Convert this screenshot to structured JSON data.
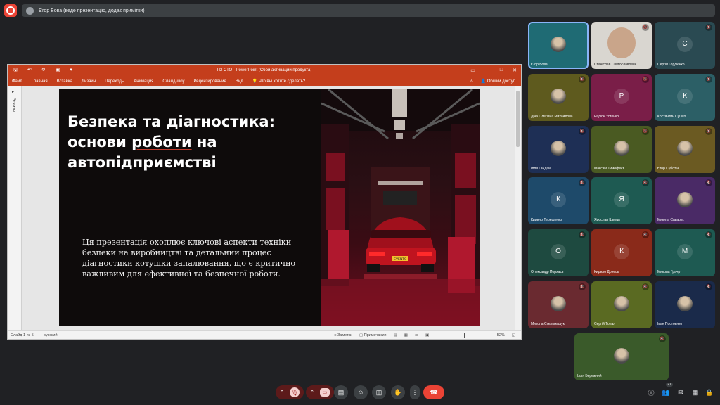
{
  "top_bar": {
    "presenter_text": "Єгор Бова (веде презентацію, додає примітки)"
  },
  "ppt": {
    "window_title": "П2 СТО - PowerPoint (Сбой активации продукта)",
    "menu": [
      "Файл",
      "Главная",
      "Вставка",
      "Дизайн",
      "Переходы",
      "Анимация",
      "Слайд-шоу",
      "Рецензирование",
      "Вид"
    ],
    "tell_me": "Что вы хотите сделать?",
    "share": "Общий доступ",
    "thumbs_label": "Эскизы",
    "status": {
      "slide": "Слайд 1 из 5",
      "lang": "русский",
      "notes": "Заметки",
      "comments": "Примечания",
      "zoom": "52%"
    },
    "slide": {
      "title_line1": "Безпека та діагностика:",
      "title_line2_a": "основи",
      "title_line2_b": "роботи",
      "title_line2_c": "на",
      "title_line3": "автопідприємстві",
      "body": "Ця презентація охоплює ключові аспекти техніки безпеки на виробництві та детальний процес діагностики котушки запалювання, що є критично важливим для ефективної та безпечної роботи.",
      "plate": "EVENTS"
    }
  },
  "participants": [
    {
      "name": "Єгор Бова",
      "initial": "",
      "bg": "#1f6b74",
      "active": true
    },
    {
      "name": "Станіслав Святославович",
      "initial": "",
      "bg": "#d9d6d0",
      "active": false
    },
    {
      "name": "Сергій Гордієнко",
      "initial": "С",
      "bg": "#2a4a52",
      "active": false
    },
    {
      "name": "Діна Олегівна Михайлова",
      "initial": "",
      "bg": "#5e5a1e",
      "active": false
    },
    {
      "name": "Радіон Устенко",
      "initial": "Р",
      "bg": "#7a1e48",
      "active": false
    },
    {
      "name": "Костянтин Сушко",
      "initial": "К",
      "bg": "#2c5f66",
      "active": false
    },
    {
      "name": "Ілля Гайдай",
      "initial": "",
      "bg": "#1e2f55",
      "active": false
    },
    {
      "name": "Максим Тимофеєв",
      "initial": "",
      "bg": "#4a5a22",
      "active": false
    },
    {
      "name": "Єгор Суботін",
      "initial": "",
      "bg": "#6b5a22",
      "active": false
    },
    {
      "name": "Кирило Терещенко",
      "initial": "К",
      "bg": "#1e4a6a",
      "active": false
    },
    {
      "name": "Ярослав Швець",
      "initial": "Я",
      "bg": "#1e5a52",
      "active": false
    },
    {
      "name": "Микита Саварук",
      "initial": "",
      "bg": "#4a2a66",
      "active": false
    },
    {
      "name": "Олександр Порхаєв",
      "initial": "О",
      "bg": "#1e4a40",
      "active": false
    },
    {
      "name": "Кирило Донець",
      "initial": "К",
      "bg": "#8a2a1a",
      "active": false
    },
    {
      "name": "Микола Грачр",
      "initial": "М",
      "bg": "#1e5a52",
      "active": false
    },
    {
      "name": "Микола Стельмашук",
      "initial": "",
      "bg": "#6a2a30",
      "active": false
    },
    {
      "name": "Сергій Топал",
      "initial": "",
      "bg": "#5a6a22",
      "active": false
    },
    {
      "name": "Іван Постоєнко",
      "initial": "",
      "bg": "#1a2a4a",
      "active": false
    },
    {
      "name": "Ілля Бережний",
      "initial": "",
      "bg": "#3a5a2a",
      "active": false
    }
  ],
  "controls": {
    "people_count": "21"
  },
  "colors": {
    "ppt_accent": "#c43e1c",
    "hangup": "#ea4335",
    "mic_off": "#8b1a1a"
  }
}
